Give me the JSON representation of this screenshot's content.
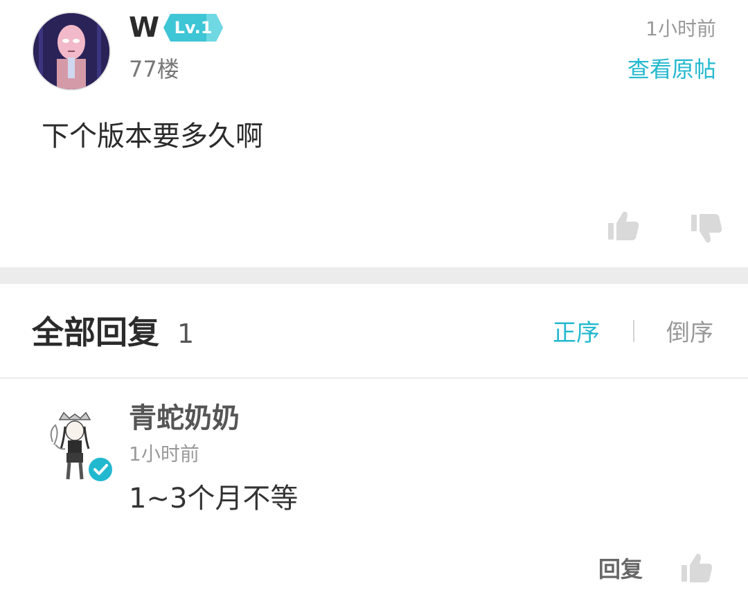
{
  "post": {
    "username": "W",
    "level": "Lv.1",
    "floor": "77楼",
    "time": "1小时前",
    "view_original": "查看原帖",
    "content": "下个版本要多久啊"
  },
  "replies_section": {
    "title": "全部回复",
    "count": "1",
    "sort_asc": "正序",
    "sort_desc": "倒序"
  },
  "replies": [
    {
      "username": "青蛇奶奶",
      "time": "1小时前",
      "content": "1~3个月不等",
      "reply_label": "回复"
    }
  ],
  "icons": {
    "like": "thumbs-up-icon",
    "dislike": "thumbs-down-icon",
    "verified": "check-badge-icon"
  },
  "colors": {
    "accent": "#22b8cf",
    "level_badge": "#3ec5d6",
    "icon_gray": "#d9d9d9",
    "divider": "#ececec"
  }
}
